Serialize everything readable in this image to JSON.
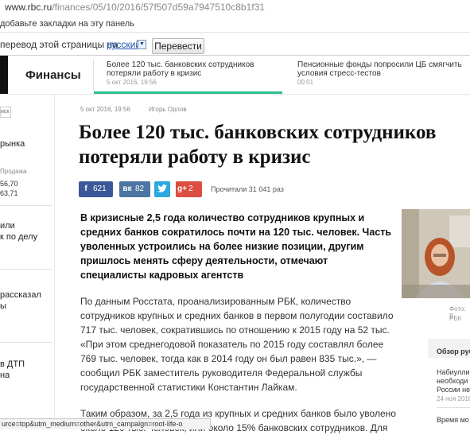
{
  "browser": {
    "url_host": "www.rbc.ru",
    "url_rest": "/finances/05/10/2016/57f507d59a7947510c8b1f31",
    "bookmarks_hint": "добавьте закладки на эту панель",
    "translate_prompt": "перевод этой страницы на",
    "translate_language": "русский",
    "translate_button": "Перевести",
    "status_url": "urce=top&utm_medium=other&utm_campaign=root-life-o"
  },
  "header": {
    "section": "Финансы",
    "news": [
      {
        "title": "Более 120 тыс. банковских сотрудников потеряли работу в кризис",
        "time": "5 окт 2016, 19:56"
      },
      {
        "title": "Пенсионные фонды попросили ЦБ смягчить условия стресс-тестов",
        "time": "00:01"
      }
    ],
    "accent": "#2bbf8f"
  },
  "left_sidebar": {
    "search_label": "иск",
    "item1": "рынка",
    "sale_label": "Продажа",
    "rate1": "56,70",
    "rate2": "63,71",
    "item2_line1": "или",
    "item2_line2": "к по делу",
    "item3_line1": "рассказал",
    "item3_line2": "ы",
    "item4_line1": "в ДТП",
    "item4_line2": "на"
  },
  "article": {
    "date": "5 окт 2016, 19:56",
    "author": "Игорь Орлов",
    "headline": "Более 120 тыс. банковских сотрудников потеряли работу в кризис",
    "share": {
      "facebook": "621",
      "vk": "82",
      "google_plus": "2"
    },
    "reads": "Прочитали 31 041 раз",
    "lead": "В кризисные 2,5 года количество сотрудников крупных и средних банков сократилось почти на 120 тыс. человек. Часть уволенных устроились на более низкие позиции, другим пришлось менять сферу деятельности, отмечают специалисты кадровых агентств",
    "paragraph1": "По данным Росстата, проанализированным РБК, количество сотрудников крупных и средних банков в первом полугодии составило 717 тыс. человек, сократившись по отношению к 2015 году на 52 тыс. «При этом среднегодовой показатель по 2015 году составлял более 769 тыс. человек, тогда как в 2014 году он был равен 835 тыс.», — сообщил РБК заместитель руководителя Федеральной службы государственной статистики Константин Лайкам.",
    "paragraph2": "Таким образом, за 2,5 года из крупных и средних банков было уволено около 120 тыс. человек, или около 15% банковских сотрудников. Для"
  },
  "right_column": {
    "photo_caption1": "Фото: В",
    "photo_caption2": "РБК",
    "review_title": "Обзор рубрик",
    "items": [
      {
        "title": "Набиуллина",
        "line2": "необходи",
        "line3": "России не",
        "date": "24 ноя 2016"
      },
      {
        "title": "Время мо",
        "line2": "",
        "line3": "",
        "date": ""
      }
    ]
  }
}
